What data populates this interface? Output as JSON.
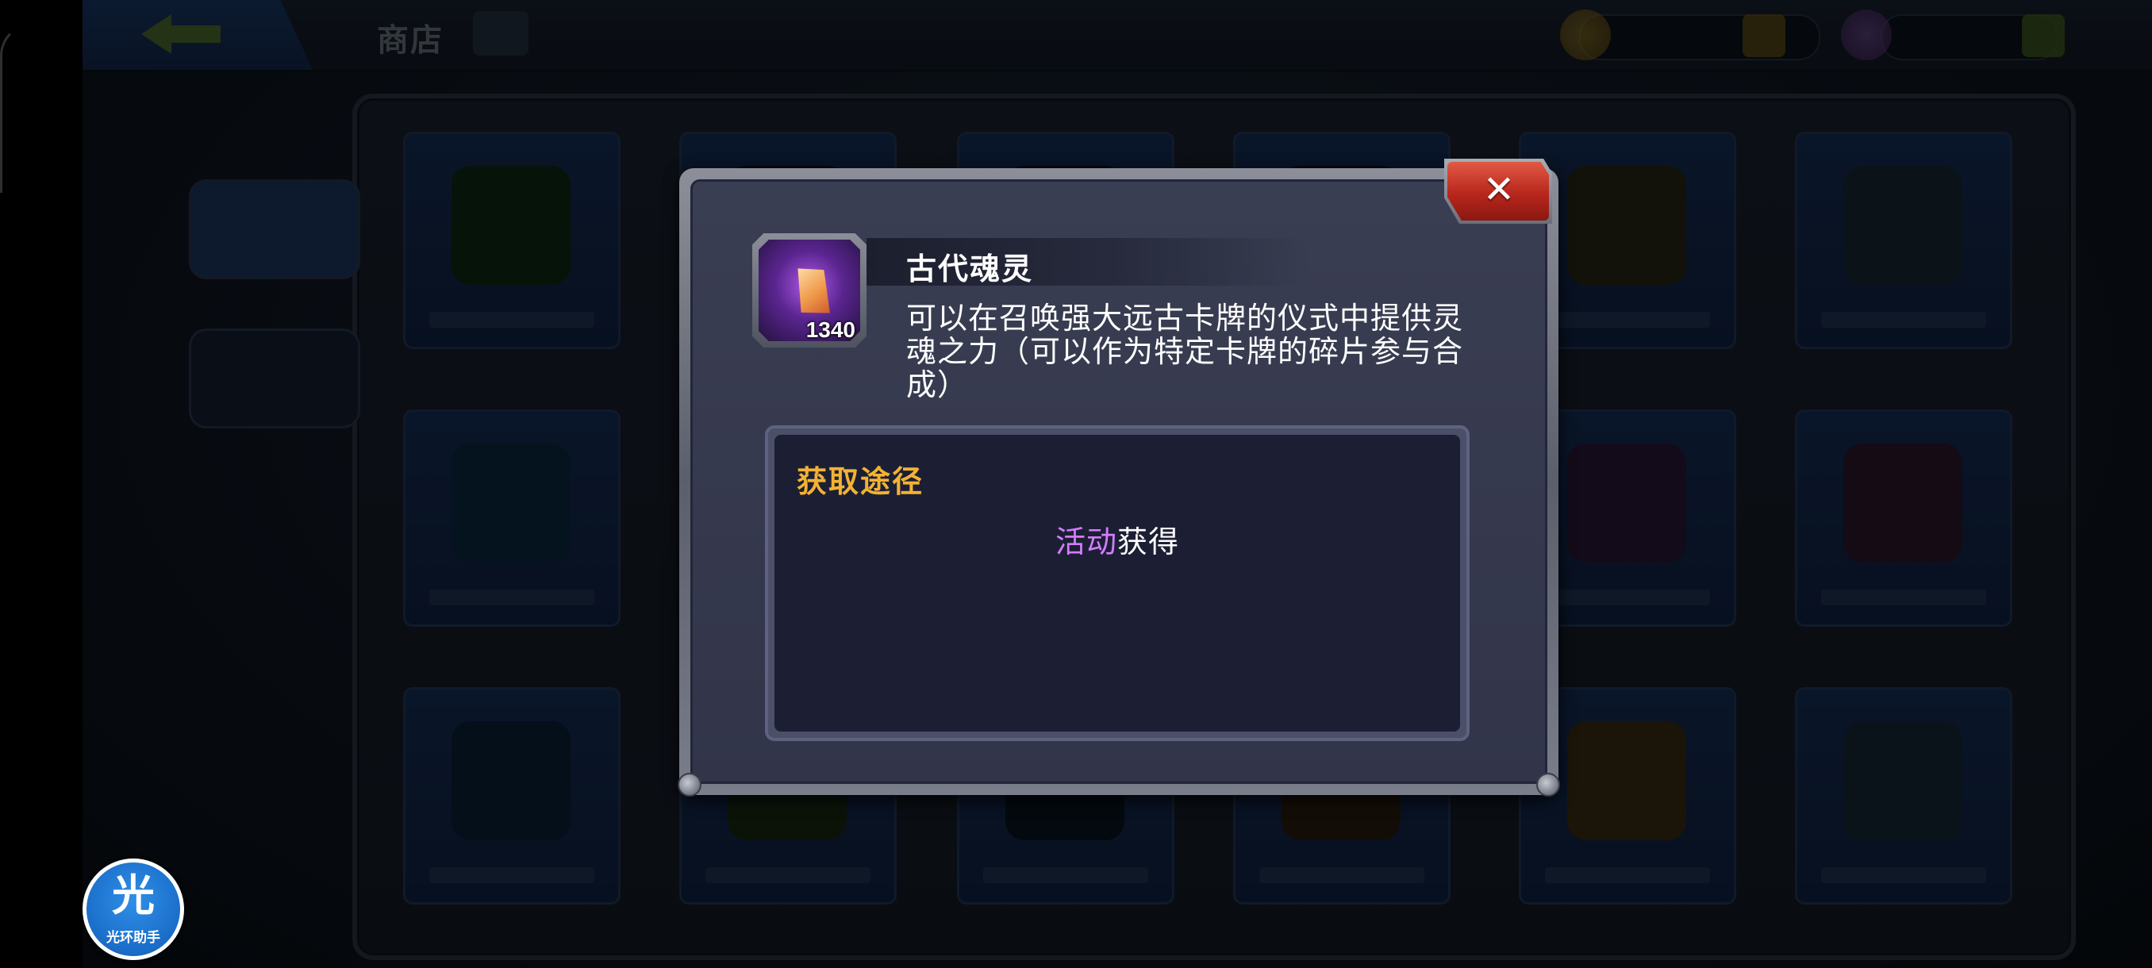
{
  "background": {
    "top_title": "商店"
  },
  "dialog": {
    "item": {
      "name": "古代魂灵",
      "count": "1340",
      "description": "可以在召唤强大远古卡牌的仪式中提供灵魂之力（可以作为特定卡牌的碎片参与合成）"
    },
    "acquire": {
      "title": "获取途径",
      "source_highlight": "活动",
      "source_rest": "获得"
    },
    "close_icon": "close-icon"
  },
  "assistant_badge": {
    "glyph": "光",
    "label": "光环助手"
  },
  "colors": {
    "acquire_title": "#f2b233",
    "source_highlight": "#d47cff",
    "close_button": "#c0281e",
    "dialog_bg": "#363a4e"
  }
}
